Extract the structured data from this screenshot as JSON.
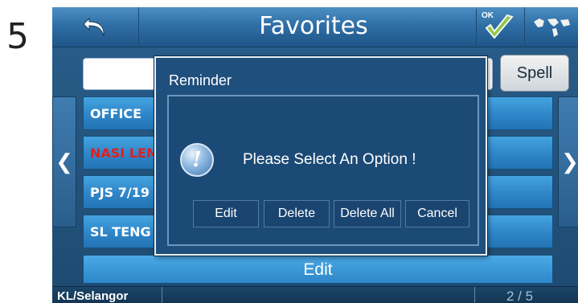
{
  "step_number": "5",
  "header": {
    "title": "Favorites",
    "ok_label": "OK"
  },
  "spell_button": "Spell",
  "list": [
    {
      "label": "OFFICE",
      "color": "#ffffff"
    },
    {
      "label": "NASI LEM",
      "color": "#e02020"
    },
    {
      "label": "PJS 7/19",
      "color": "#ffffff"
    },
    {
      "label": "SL TENG",
      "color": "#ffffff"
    }
  ],
  "edit_bar": "Edit",
  "footer": {
    "region": "KL/Selangor",
    "page": "2 / 5"
  },
  "dialog": {
    "title": "Reminder",
    "message": "Please Select An Option !",
    "buttons": {
      "edit": "Edit",
      "delete": "Delete",
      "delete_all": "Delete All",
      "cancel": "Cancel"
    }
  }
}
